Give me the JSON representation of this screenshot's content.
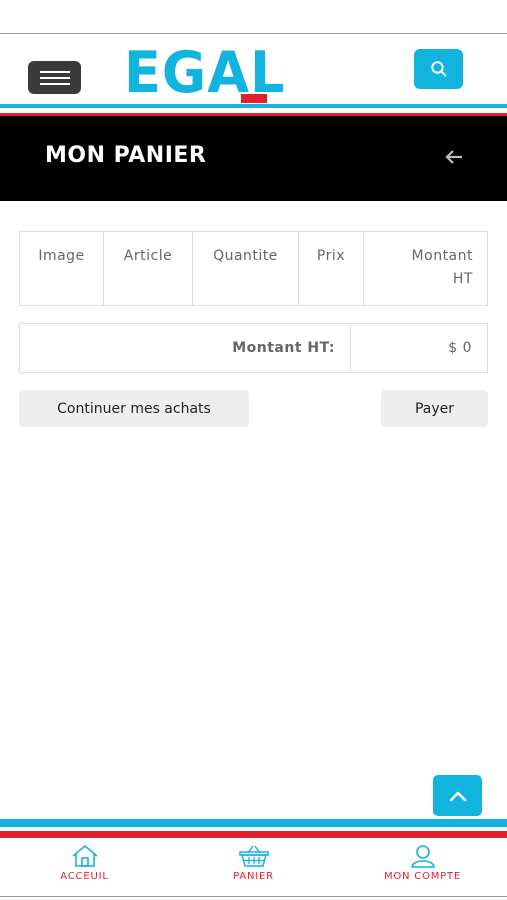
{
  "header": {
    "logo_text": "EGAL",
    "menu_icon": "hamburger-icon",
    "search_icon": "search-icon"
  },
  "page": {
    "title": "MON PANIER",
    "back_icon": "arrow-left-icon"
  },
  "cart_table": {
    "columns": [
      "Image",
      "Article",
      "Quantite",
      "Prix",
      "Montant",
      "HT"
    ],
    "rows": []
  },
  "totals": {
    "label": "Montant HT:",
    "value": "$ 0"
  },
  "actions": {
    "continue_label": "Continuer mes achats",
    "pay_label": "Payer"
  },
  "bottom_nav": {
    "items": [
      {
        "label": "ACCEUIL",
        "icon": "home-icon"
      },
      {
        "label": "PANIER",
        "icon": "basket-icon"
      },
      {
        "label": "MON COMPTE",
        "icon": "user-icon"
      }
    ]
  },
  "colors": {
    "brand_blue": "#11b4de",
    "brand_red": "#e2202d",
    "title_bar": "#000000"
  }
}
